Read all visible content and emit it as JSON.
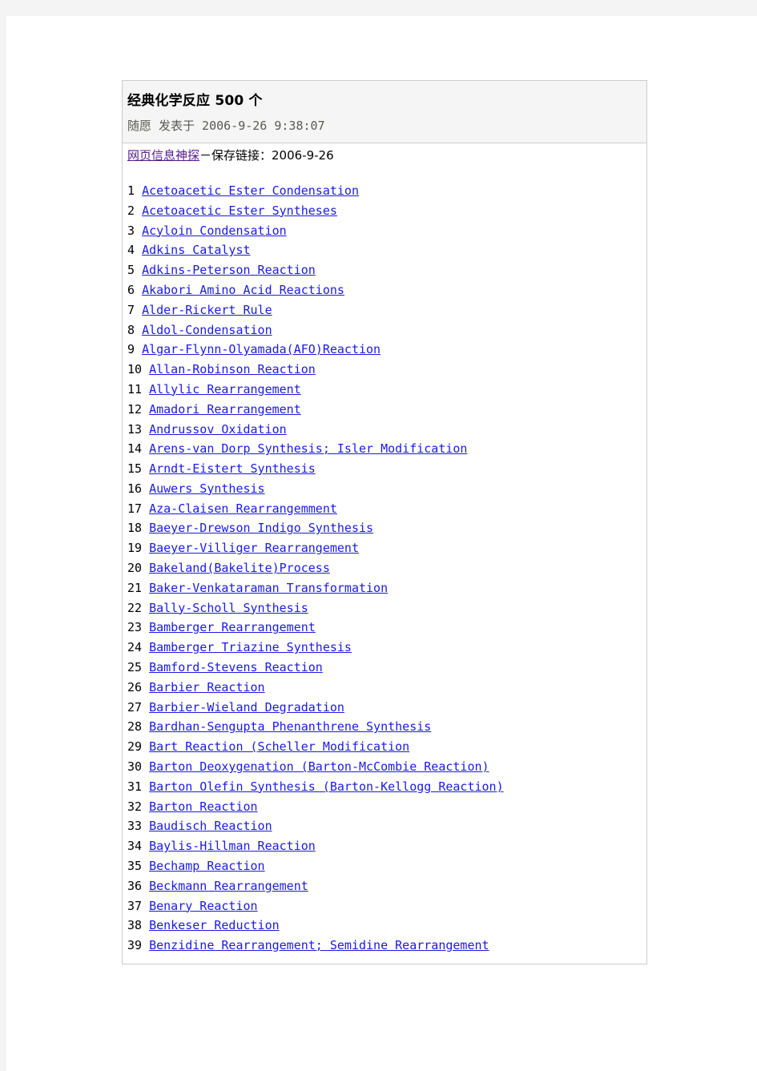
{
  "article": {
    "title": "经典化学反应 500 个",
    "byline": "随愿 发表于 2006-9-26 9:38:07",
    "source": {
      "link_text": "网页信息神探",
      "suffix": "－保存链接：2006-9-26"
    }
  },
  "colors": {
    "page_background": "#f4f4f4",
    "sheet_background": "#ffffff",
    "box_border": "#cccccc",
    "header_background": "#f5f5f5",
    "title_text": "#000000",
    "byline_text": "#5a5a52",
    "link_unvisited": "#1a1ae6",
    "link_visited": "#551a8b"
  },
  "list": {
    "items": [
      {
        "index": "1",
        "name": "Acetoacetic Ester Condensation"
      },
      {
        "index": "2",
        "name": "Acetoacetic Ester Syntheses"
      },
      {
        "index": "3",
        "name": "Acyloin Condensation"
      },
      {
        "index": "4",
        "name": "Adkins Catalyst"
      },
      {
        "index": "5",
        "name": "Adkins-Peterson Reaction"
      },
      {
        "index": "6",
        "name": "Akabori Amino Acid Reactions"
      },
      {
        "index": "7",
        "name": "Alder-Rickert Rule"
      },
      {
        "index": "8",
        "name": "Aldol-Condensation"
      },
      {
        "index": "9",
        "name": "Algar-Flynn-Olyamada(AFO)Reaction"
      },
      {
        "index": "10",
        "name": "Allan-Robinson Reaction"
      },
      {
        "index": "11",
        "name": "Allylic Rearrangement"
      },
      {
        "index": "12",
        "name": "Amadori Rearrangement"
      },
      {
        "index": "13",
        "name": "Andrussov Oxidation"
      },
      {
        "index": "14",
        "name": "Arens-van Dorp Synthesis; Isler Modification"
      },
      {
        "index": "15",
        "name": "Arndt-Eistert Synthesis"
      },
      {
        "index": "16",
        "name": "Auwers Synthesis"
      },
      {
        "index": "17",
        "name": "Aza-Claisen Rearrangemment"
      },
      {
        "index": "18",
        "name": "Baeyer-Drewson Indigo Synthesis"
      },
      {
        "index": "19",
        "name": "Baeyer-Villiger Rearrangement"
      },
      {
        "index": "20",
        "name": "Bakeland(Bakelite)Process"
      },
      {
        "index": "21",
        "name": "Baker-Venkataraman Transformation"
      },
      {
        "index": "22",
        "name": "Bally-Scholl Synthesis"
      },
      {
        "index": "23",
        "name": "Bamberger Rearrangement"
      },
      {
        "index": "24",
        "name": "Bamberger Triazine Synthesis"
      },
      {
        "index": "25",
        "name": "Bamford-Stevens Reaction"
      },
      {
        "index": "26",
        "name": "Barbier Reaction"
      },
      {
        "index": "27",
        "name": "Barbier-Wieland Degradation"
      },
      {
        "index": "28",
        "name": "Bardhan-Sengupta Phenanthrene Synthesis"
      },
      {
        "index": "29",
        "name": "Bart Reaction (Scheller Modification"
      },
      {
        "index": "30",
        "name": "Barton Deoxygenation (Barton-McCombie Reaction)"
      },
      {
        "index": "31",
        "name": "Barton Olefin Synthesis (Barton-Kellogg Reaction)"
      },
      {
        "index": "32",
        "name": "Barton Reaction"
      },
      {
        "index": "33",
        "name": "Baudisch Reaction"
      },
      {
        "index": "34",
        "name": "Baylis-Hillman Reaction"
      },
      {
        "index": "35",
        "name": "Bechamp Reaction"
      },
      {
        "index": "36",
        "name": "Beckmann Rearrangement"
      },
      {
        "index": "37",
        "name": "Benary Reaction"
      },
      {
        "index": "38",
        "name": "Benkeser Reduction"
      },
      {
        "index": "39",
        "name": "Benzidine Rearrangement; Semidine Rearrangement"
      }
    ]
  }
}
